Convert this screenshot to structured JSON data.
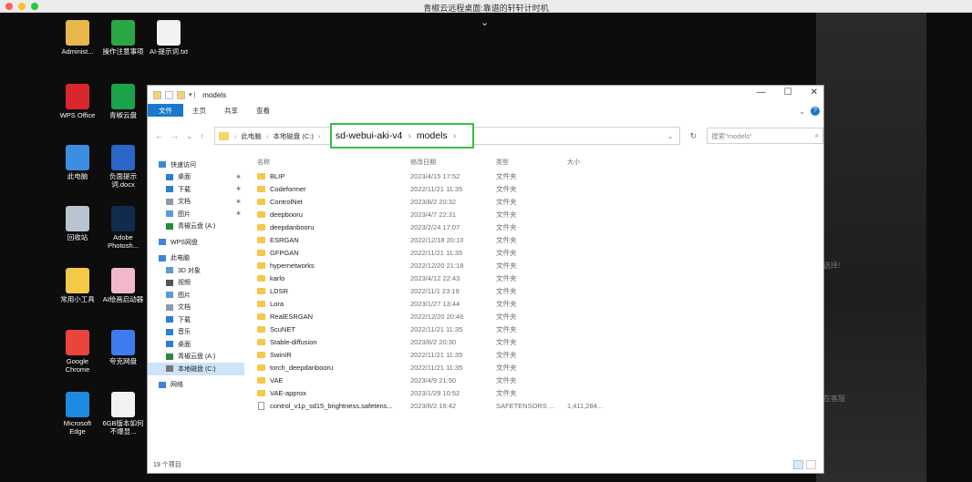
{
  "mac": {
    "title": "青椒云远程桌面:靠谱的轩轩计时机"
  },
  "desktop": {
    "icons": [
      {
        "name": "administrator",
        "label": "Administ...",
        "color": "#e8b84a"
      },
      {
        "name": "notice-doc",
        "label": "操作注意事项",
        "color": "#2aa646"
      },
      {
        "name": "prompt-txt",
        "label": "AI-提示词.txt",
        "color": "#f2f2f2"
      },
      {
        "name": "wps-office",
        "label": "WPS Office",
        "color": "#d9272e"
      },
      {
        "name": "qingjiao-disk",
        "label": "青椒云盘",
        "color": "#1aa34a"
      },
      {
        "name": "this-pc",
        "label": "此电脑",
        "color": "#3d8ee0"
      },
      {
        "name": "neg-prompt-docx",
        "label": "负面提示词.docx",
        "color": "#2b66c8"
      },
      {
        "name": "recycle-bin",
        "label": "回收站",
        "color": "#b8c4cf"
      },
      {
        "name": "adobe-photoshop",
        "label": "Adobe Photosh...",
        "color": "#0f2c4d"
      },
      {
        "name": "common-tools",
        "label": "常用小工具",
        "color": "#f3c94a"
      },
      {
        "name": "ai-launcher",
        "label": "AI绘画启动器",
        "color": "#f1b8c9"
      },
      {
        "name": "google-chrome",
        "label": "Google Chrome",
        "color": "#e8453c"
      },
      {
        "name": "kuake-disk",
        "label": "夸克网盘",
        "color": "#3f7bf0"
      },
      {
        "name": "microsoft-edge",
        "label": "Microsoft Edge",
        "color": "#1d8ce0"
      },
      {
        "name": "6gb-doc",
        "label": "6GB版本如何不爆显...",
        "color": "#f2f2f2"
      }
    ],
    "ghost_1": "选择!",
    "ghost_2": "在客服"
  },
  "explorer": {
    "title": "models",
    "window_controls": {
      "min": "—",
      "max": "☐",
      "close": "✕"
    },
    "ribbon_tabs": {
      "file": "文件",
      "home": "主页",
      "share": "共享",
      "view": "查看"
    },
    "address": {
      "this_pc": "此电脑",
      "drive": "本地磁盘 (C:)",
      "folder1": "sd-webui-aki-v4",
      "folder2": "models"
    },
    "search_placeholder": "搜索\"models\"",
    "nav": [
      {
        "label": "快速访问",
        "color": "#3a86d9",
        "pin": false,
        "sel": false
      },
      {
        "label": "桌面",
        "color": "#2a7fd4",
        "pin": true,
        "sel": false
      },
      {
        "label": "下载",
        "color": "#2a7fd4",
        "pin": true,
        "sel": false
      },
      {
        "label": "文档",
        "color": "#8a9bb0",
        "pin": true,
        "sel": false
      },
      {
        "label": "图片",
        "color": "#5b9bd5",
        "pin": true,
        "sel": false
      },
      {
        "label": "青椒云盘 (A:)",
        "color": "#2a8a3a",
        "pin": false,
        "sel": false
      },
      {
        "label": "WPS网盘",
        "color": "#3a86d9",
        "pin": false,
        "sel": false
      },
      {
        "label": "此电脑",
        "color": "#3a86d9",
        "pin": false,
        "sel": false
      },
      {
        "label": "3D 对象",
        "color": "#5b9bd5",
        "pin": false,
        "sel": false
      },
      {
        "label": "视频",
        "color": "#555",
        "pin": false,
        "sel": false
      },
      {
        "label": "图片",
        "color": "#5b9bd5",
        "pin": false,
        "sel": false
      },
      {
        "label": "文档",
        "color": "#8a9bb0",
        "pin": false,
        "sel": false
      },
      {
        "label": "下载",
        "color": "#2a7fd4",
        "pin": false,
        "sel": false
      },
      {
        "label": "音乐",
        "color": "#2a7fd4",
        "pin": false,
        "sel": false
      },
      {
        "label": "桌面",
        "color": "#2a7fd4",
        "pin": false,
        "sel": false
      },
      {
        "label": "青椒云盘 (A:)",
        "color": "#2a8a3a",
        "pin": false,
        "sel": false
      },
      {
        "label": "本地磁盘 (C:)",
        "color": "#777",
        "pin": false,
        "sel": true
      },
      {
        "label": "网络",
        "color": "#3a86d9",
        "pin": false,
        "sel": false
      }
    ],
    "columns": {
      "name": "名称",
      "date": "修改日期",
      "type": "类型",
      "size": "大小"
    },
    "files": [
      {
        "name": "BLIP",
        "date": "2023/4/15 17:52",
        "type": "文件夹",
        "size": "",
        "folder": true
      },
      {
        "name": "Codeformer",
        "date": "2022/11/21 11:35",
        "type": "文件夹",
        "size": "",
        "folder": true
      },
      {
        "name": "ControlNet",
        "date": "2023/8/2 20:32",
        "type": "文件夹",
        "size": "",
        "folder": true
      },
      {
        "name": "deepbooru",
        "date": "2023/4/7 22:31",
        "type": "文件夹",
        "size": "",
        "folder": true
      },
      {
        "name": "deepdanbooru",
        "date": "2023/2/24 17:07",
        "type": "文件夹",
        "size": "",
        "folder": true
      },
      {
        "name": "ESRGAN",
        "date": "2022/12/18 20:10",
        "type": "文件夹",
        "size": "",
        "folder": true
      },
      {
        "name": "GFPGAN",
        "date": "2022/11/21 11:35",
        "type": "文件夹",
        "size": "",
        "folder": true
      },
      {
        "name": "hypernetworks",
        "date": "2022/12/20 21:18",
        "type": "文件夹",
        "size": "",
        "folder": true
      },
      {
        "name": "karlo",
        "date": "2023/4/12 22:43",
        "type": "文件夹",
        "size": "",
        "folder": true
      },
      {
        "name": "LDSR",
        "date": "2022/11/1 23:19",
        "type": "文件夹",
        "size": "",
        "folder": true
      },
      {
        "name": "Lora",
        "date": "2023/1/27 13:44",
        "type": "文件夹",
        "size": "",
        "folder": true
      },
      {
        "name": "RealESRGAN",
        "date": "2022/12/20 20:46",
        "type": "文件夹",
        "size": "",
        "folder": true
      },
      {
        "name": "ScuNET",
        "date": "2022/11/21 11:35",
        "type": "文件夹",
        "size": "",
        "folder": true
      },
      {
        "name": "Stable-diffusion",
        "date": "2023/8/2 20:30",
        "type": "文件夹",
        "size": "",
        "folder": true
      },
      {
        "name": "SwinIR",
        "date": "2022/11/21 11:35",
        "type": "文件夹",
        "size": "",
        "folder": true
      },
      {
        "name": "torch_deepdanbooru",
        "date": "2022/11/21 11:35",
        "type": "文件夹",
        "size": "",
        "folder": true
      },
      {
        "name": "VAE",
        "date": "2023/4/9 21:50",
        "type": "文件夹",
        "size": "",
        "folder": true
      },
      {
        "name": "VAE-approx",
        "date": "2023/1/29 10:52",
        "type": "文件夹",
        "size": "",
        "folder": true
      },
      {
        "name": "control_v1p_sd15_brightness.safetens...",
        "date": "2023/8/2 16:42",
        "type": "SAFETENSORS ...",
        "size": "1,411,284...",
        "folder": false
      }
    ],
    "status": "19 个项目"
  }
}
